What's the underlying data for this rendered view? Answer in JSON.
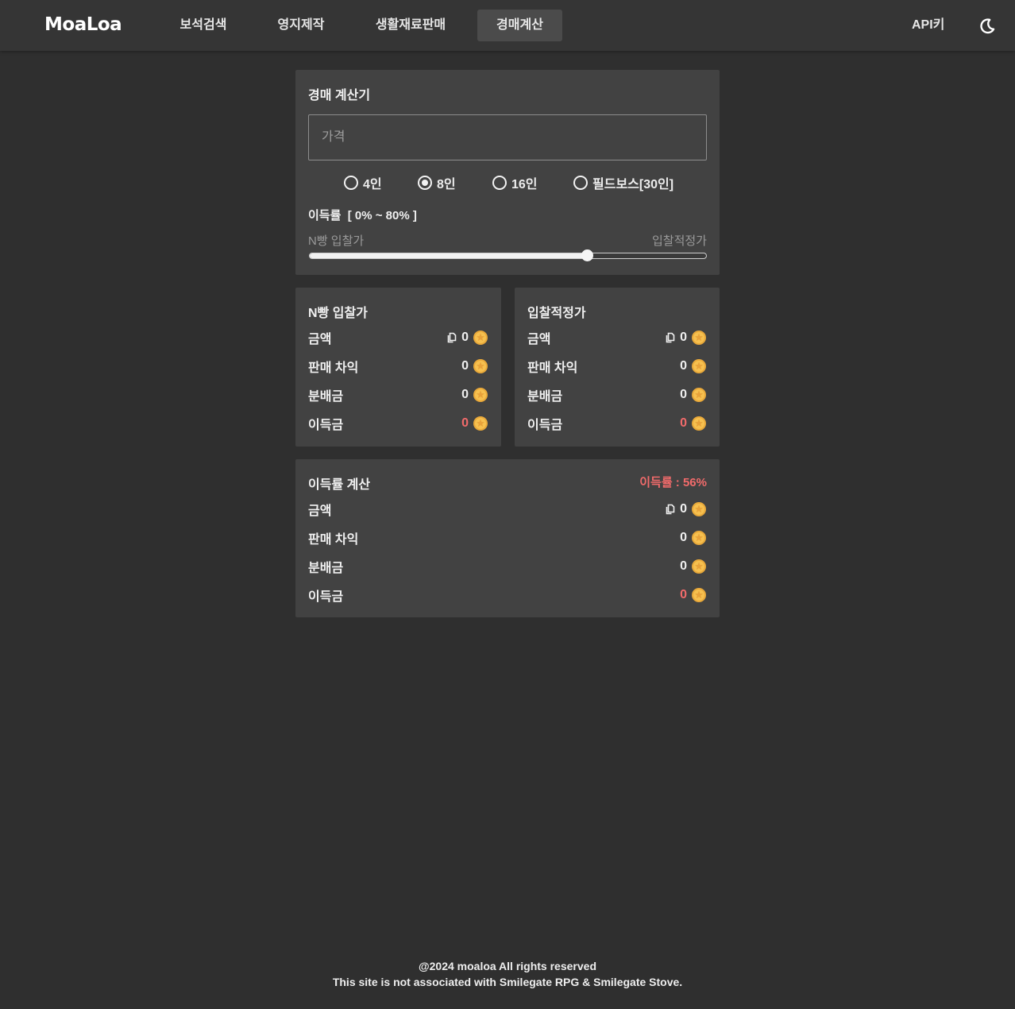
{
  "header": {
    "logo": "MoaLoa",
    "nav": [
      {
        "label": "보석검색",
        "active": false
      },
      {
        "label": "영지제작",
        "active": false
      },
      {
        "label": "생활재료판매",
        "active": false
      },
      {
        "label": "경매계산",
        "active": true
      }
    ],
    "api_key": "API키",
    "theme_icon": "moon-icon"
  },
  "calculator": {
    "title": "경매 계산기",
    "price_placeholder": "가격",
    "price_value": "",
    "party_options": [
      {
        "label": "4인",
        "checked": false
      },
      {
        "label": "8인",
        "checked": true
      },
      {
        "label": "16인",
        "checked": false
      },
      {
        "label": "필드보스[30인]",
        "checked": false
      }
    ],
    "rate_label": "이득률  [ 0% ~ 80% ]",
    "slider_left_label": "N빵 입찰가",
    "slider_right_label": "입찰적정가",
    "slider_min": 0,
    "slider_max": 80,
    "slider_value": 56
  },
  "n_split": {
    "title": "N빵 입찰가",
    "rows": [
      {
        "label": "금액",
        "value": "0",
        "copy": true,
        "red": false
      },
      {
        "label": "판매 차익",
        "value": "0",
        "copy": false,
        "red": false
      },
      {
        "label": "분배금",
        "value": "0",
        "copy": false,
        "red": false
      },
      {
        "label": "이득금",
        "value": "0",
        "copy": false,
        "red": true
      }
    ]
  },
  "fair_bid": {
    "title": "입찰적정가",
    "rows": [
      {
        "label": "금액",
        "value": "0",
        "copy": true,
        "red": false
      },
      {
        "label": "판매 차익",
        "value": "0",
        "copy": false,
        "red": false
      },
      {
        "label": "분배금",
        "value": "0",
        "copy": false,
        "red": false
      },
      {
        "label": "이득금",
        "value": "0",
        "copy": false,
        "red": true
      }
    ]
  },
  "profit_calc": {
    "title": "이득률 계산",
    "rate_text": "이득률 : 56%",
    "rows": [
      {
        "label": "금액",
        "value": "0",
        "copy": true,
        "red": false
      },
      {
        "label": "판매 차익",
        "value": "0",
        "copy": false,
        "red": false
      },
      {
        "label": "분배금",
        "value": "0",
        "copy": false,
        "red": false
      },
      {
        "label": "이득금",
        "value": "0",
        "copy": false,
        "red": true
      }
    ]
  },
  "footer": {
    "line1": "@2024 moaloa All rights reserved",
    "line2": "This site is not associated with Smilegate RPG & Smilegate Stove."
  },
  "colors": {
    "background": "#2f2f2f",
    "panel": "#424242",
    "header": "#353535",
    "accent_red": "#f26b6b",
    "coin": "#f2b33d"
  }
}
